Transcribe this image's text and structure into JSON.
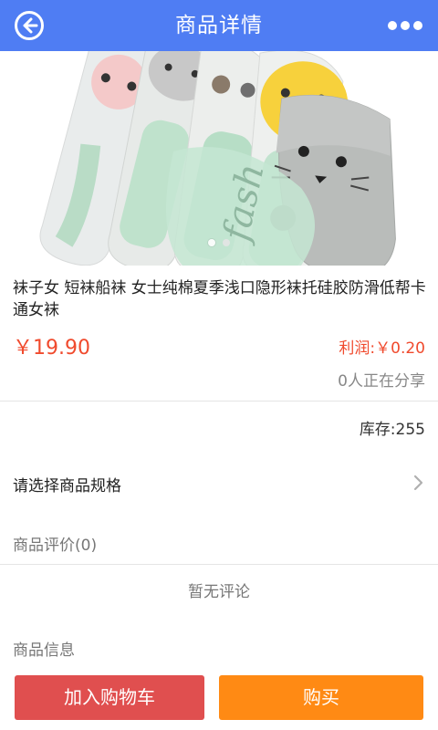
{
  "header": {
    "title": "商品详情",
    "back_icon": "back-arrow-circle-icon",
    "more_icon": "more-dots-icon",
    "color": "#4f7df3"
  },
  "gallery": {
    "image": "socks-product-photo",
    "slide_count": 2,
    "active_slide": 1
  },
  "product": {
    "title": "袜子女 短袜船袜 女士纯棉夏季浅口隐形袜托硅胶防滑低帮卡通女袜",
    "price": "￥19.90",
    "profit": "利润:￥0.20",
    "sharing": "0人正在分享",
    "stock": "库存:255",
    "accent": "#f04a2d"
  },
  "spec": {
    "label": "请选择商品规格",
    "icon": "chevron-right-icon"
  },
  "reviews": {
    "title": "商品评价(0)",
    "empty_text": "暂无评论"
  },
  "info": {
    "title": "商品信息"
  },
  "footer": {
    "add_to_cart": "加入购物车",
    "buy": "购买",
    "cart_color": "#e04f4f",
    "buy_color": "#ff8a14"
  }
}
